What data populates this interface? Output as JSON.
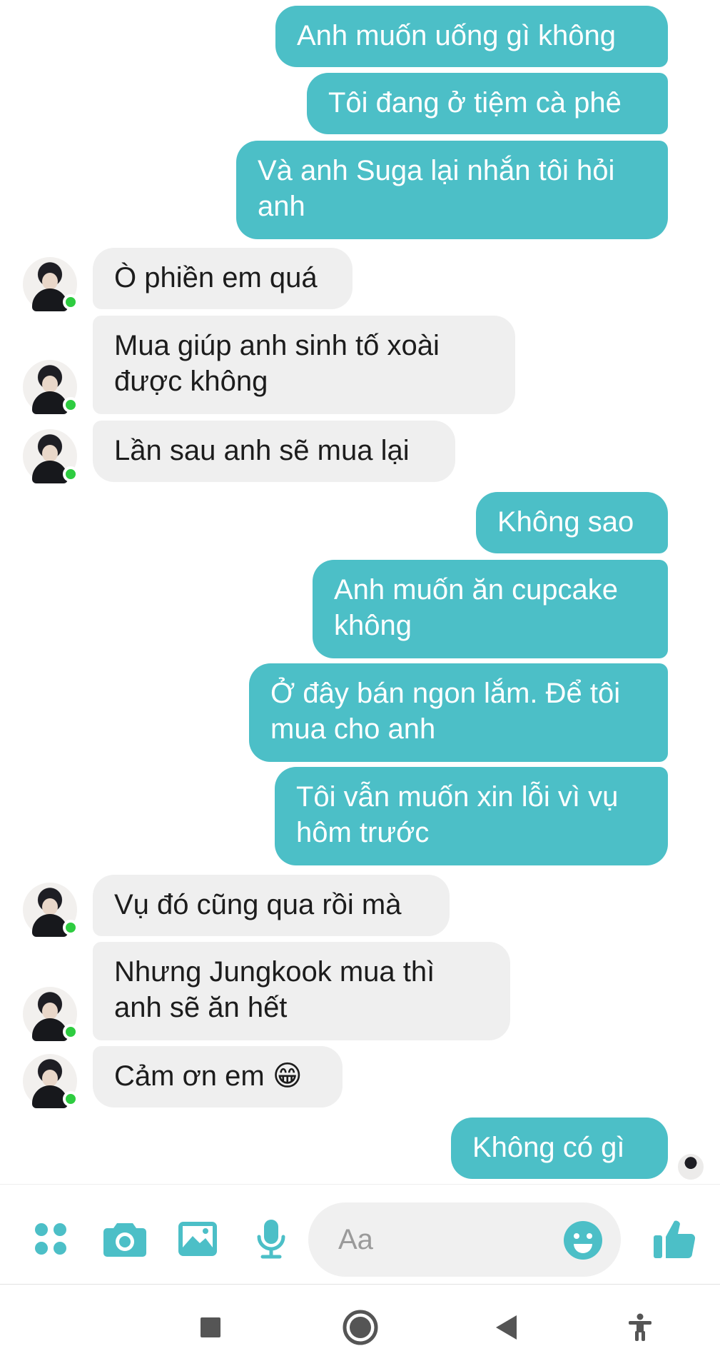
{
  "messages": [
    {
      "side": "out",
      "text": "Anh muốn uống gì không"
    },
    {
      "side": "out",
      "text": "Tôi đang ở tiệm cà phê"
    },
    {
      "side": "out",
      "text": "Và anh Suga lại nhắn tôi hỏi\nanh"
    },
    {
      "side": "in",
      "text": "Ò phiền em quá"
    },
    {
      "side": "in",
      "text": "Mua giúp anh sinh tố xoài\nđược không"
    },
    {
      "side": "in",
      "text": "Lần sau anh sẽ mua lại"
    },
    {
      "side": "out",
      "text": "Không sao"
    },
    {
      "side": "out",
      "text": "Anh muốn ăn cupcake\nkhông"
    },
    {
      "side": "out",
      "text": "Ở đây bán ngon lắm. Để tôi\nmua cho anh"
    },
    {
      "side": "out",
      "text": "Tôi vẫn muốn xin lỗi vì vụ\nhôm trước"
    },
    {
      "side": "in",
      "text": "Vụ đó cũng qua rồi mà"
    },
    {
      "side": "in",
      "text": "Nhưng Jungkook mua thì\nanh sẽ ăn hết"
    },
    {
      "side": "in",
      "text": "Cảm ơn em 😁"
    },
    {
      "side": "out",
      "text": "Không có gì"
    }
  ],
  "composer": {
    "placeholder": "Aa",
    "icons": [
      "apps-icon",
      "camera-icon",
      "image-icon",
      "microphone-icon",
      "emoji-icon",
      "like-icon"
    ]
  },
  "navigation": {
    "icons": [
      "square-recents-icon",
      "circle-home-icon",
      "triangle-back-icon",
      "accessibility-icon"
    ]
  },
  "colors": {
    "accent": "#4cbfc7",
    "incoming_bubble": "#efefef",
    "online": "#2ecc40"
  }
}
